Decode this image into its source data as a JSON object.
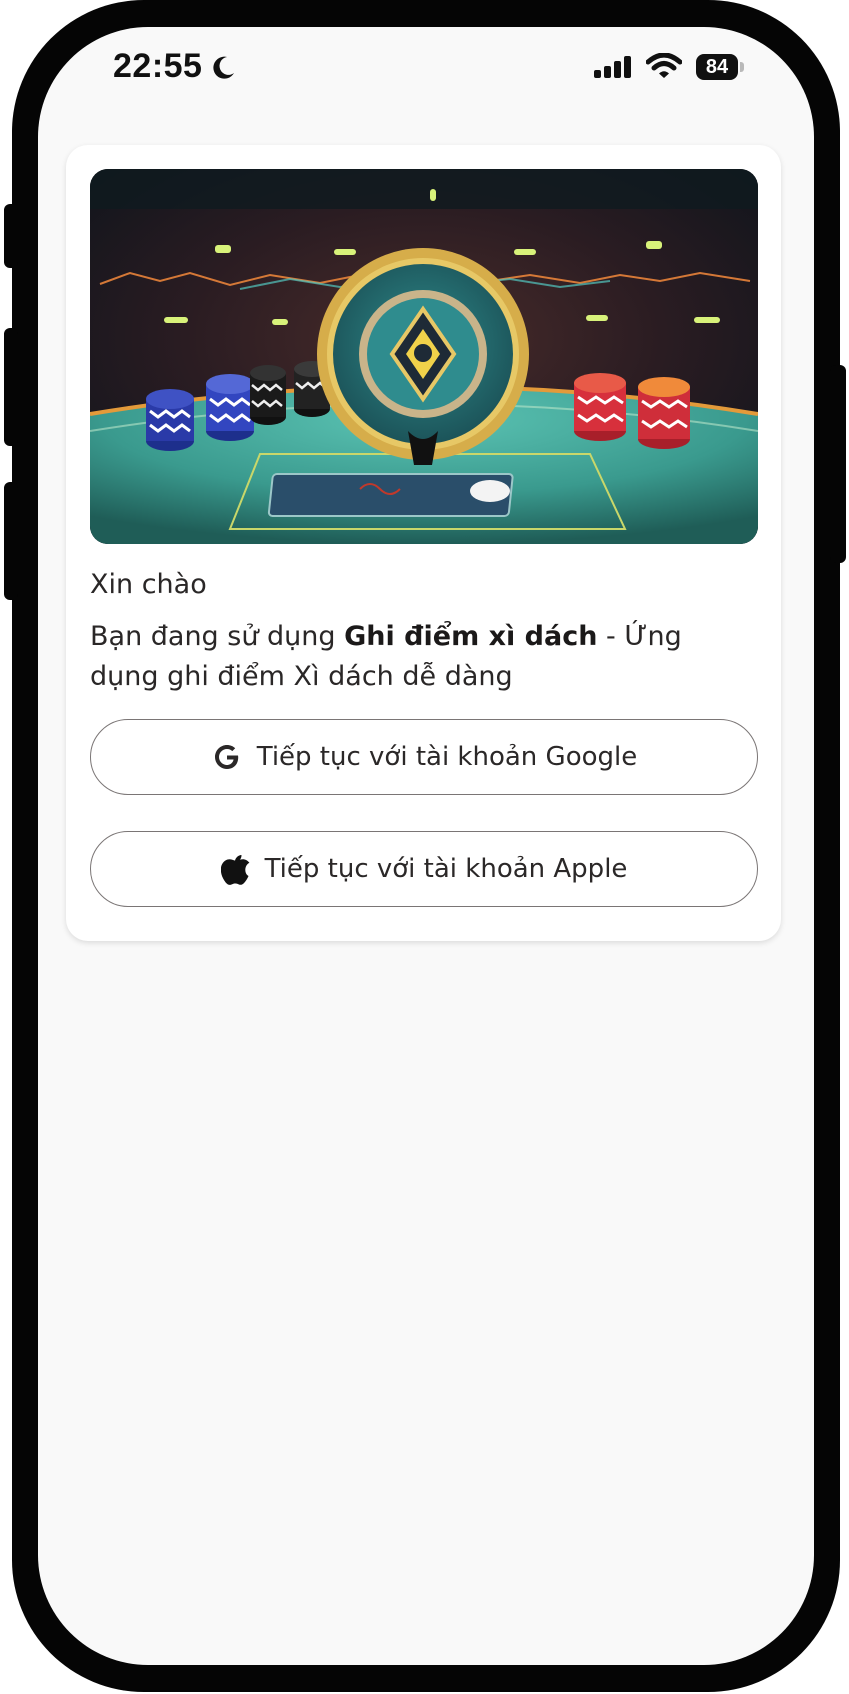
{
  "status_bar": {
    "time": "22:55",
    "battery_level": "84",
    "moon_icon": "moon-icon",
    "signal_icon": "cellular-signal-icon",
    "wifi_icon": "wifi-icon"
  },
  "card": {
    "hero_image": "casino-table-illustration",
    "greeting": "Xin chào",
    "intro": {
      "prefix": "Bạn đang sử dụng ",
      "app_name": "Ghi điểm xì dách",
      "suffix": " - Ứng dụng ghi điểm Xì dách dễ dàng"
    },
    "buttons": [
      {
        "label": "Tiếp tục với tài khoản Google",
        "icon": "google-icon"
      },
      {
        "label": "Tiếp tục với tài khoản Apple",
        "icon": "apple-icon"
      }
    ]
  },
  "colors": {
    "screen_bg": "#f9f9f9",
    "card_bg": "#ffffff",
    "button_border": "#7a7575",
    "text": "#2a2727",
    "table_teal": "#3fa397",
    "coin_gold": "#d6ad4a"
  }
}
